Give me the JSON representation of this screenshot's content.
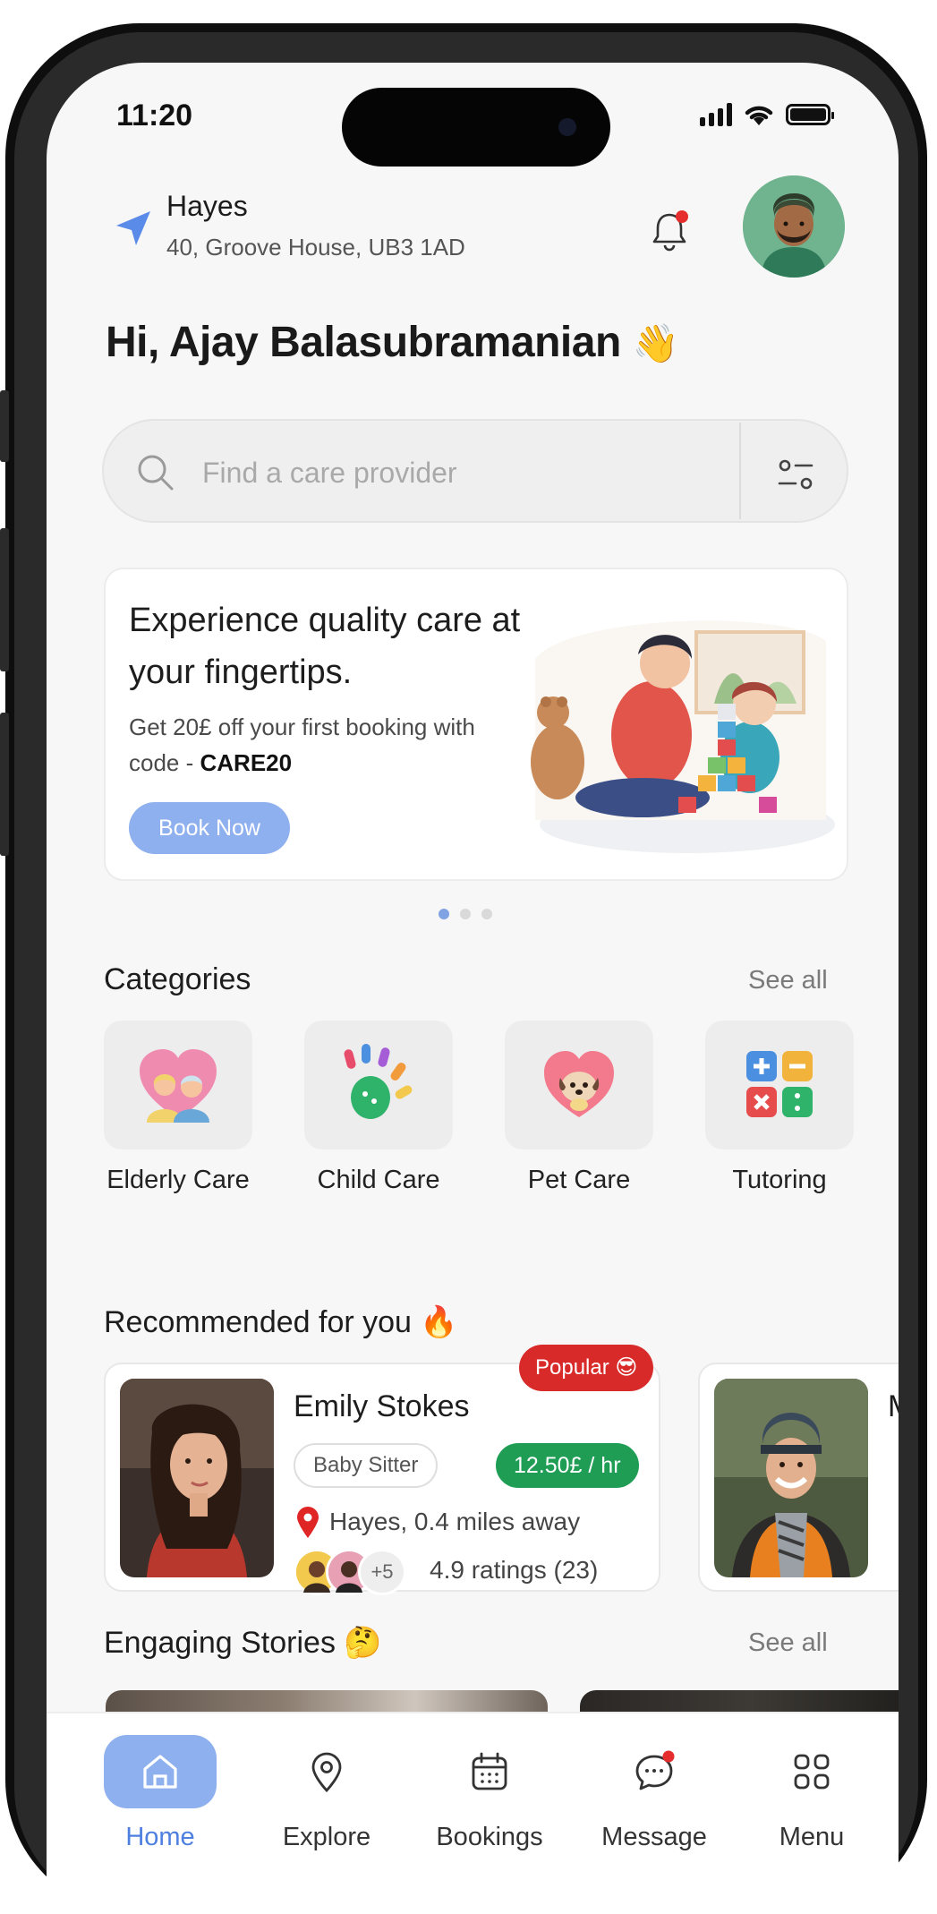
{
  "status_bar": {
    "time": "11:20"
  },
  "location": {
    "city": "Hayes",
    "address": "40, Groove House, UB3 1AD"
  },
  "greeting": {
    "text": "Hi, Ajay Balasubramanian",
    "emoji": "👋"
  },
  "search": {
    "placeholder": "Find a care provider"
  },
  "banner": {
    "title": "Experience quality care at your fingertips.",
    "subtitle_prefix": "Get 20£ off your first booking with code  - ",
    "code": "CARE20",
    "button": "Book Now"
  },
  "categories": {
    "title": "Categories",
    "see_all": "See all",
    "items": [
      {
        "label": "Elderly Care",
        "icon": "elderly-couple-heart-icon"
      },
      {
        "label": "Child Care",
        "icon": "hand-paint-icon"
      },
      {
        "label": "Pet Care",
        "icon": "dog-heart-icon"
      },
      {
        "label": "Tutoring",
        "icon": "math-symbols-icon"
      }
    ]
  },
  "recommended": {
    "title": "Recommended for you",
    "emoji": "🔥",
    "cards": [
      {
        "badge": "Popular 😎",
        "name": "Emily Stokes",
        "role": "Baby Sitter",
        "rate": "12.50£ / hr",
        "distance": "Hayes, 0.4 miles away",
        "more_reviewers": "+5",
        "rating": "4.9 ratings (23)"
      },
      {
        "name": "M"
      }
    ]
  },
  "stories": {
    "title": "Engaging Stories",
    "emoji": "🤔",
    "see_all": "See all"
  },
  "nav": {
    "items": [
      {
        "label": "Home",
        "active": true
      },
      {
        "label": "Explore"
      },
      {
        "label": "Bookings"
      },
      {
        "label": "Message"
      },
      {
        "label": "Menu"
      }
    ]
  },
  "colors": {
    "accent": "#8fb0ee",
    "accent_text": "#4d7fe0",
    "rate_badge": "#1f9d55",
    "popular_badge": "#d92a2a"
  }
}
